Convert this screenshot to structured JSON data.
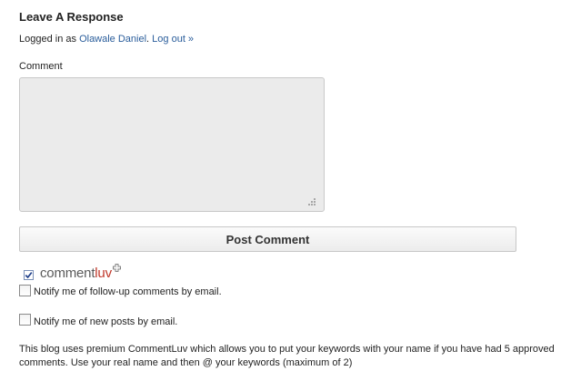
{
  "form": {
    "heading": "Leave A Response",
    "logged_in_prefix": "Logged in as ",
    "user_name": "Olawale Daniel",
    "separator": ". ",
    "logout_label": "Log out »",
    "comment_label": "Comment",
    "comment_value": "",
    "submit_label": "Post Comment"
  },
  "commentluv": {
    "enabled": true,
    "logo_part1": "comment",
    "logo_part2": "luv"
  },
  "options": [
    {
      "label": "Notify me of follow-up comments by email.",
      "checked": false
    },
    {
      "label": "Notify me of new posts by email.",
      "checked": false
    }
  ],
  "note": "This blog uses premium CommentLuv which allows you to put your keywords with your name if you have had 5 approved comments. Use your real name and then @ your keywords (maximum of 2)",
  "colors": {
    "link": "#2a5d9b",
    "luv": "#c0392b",
    "textarea_bg": "#ebebeb"
  }
}
